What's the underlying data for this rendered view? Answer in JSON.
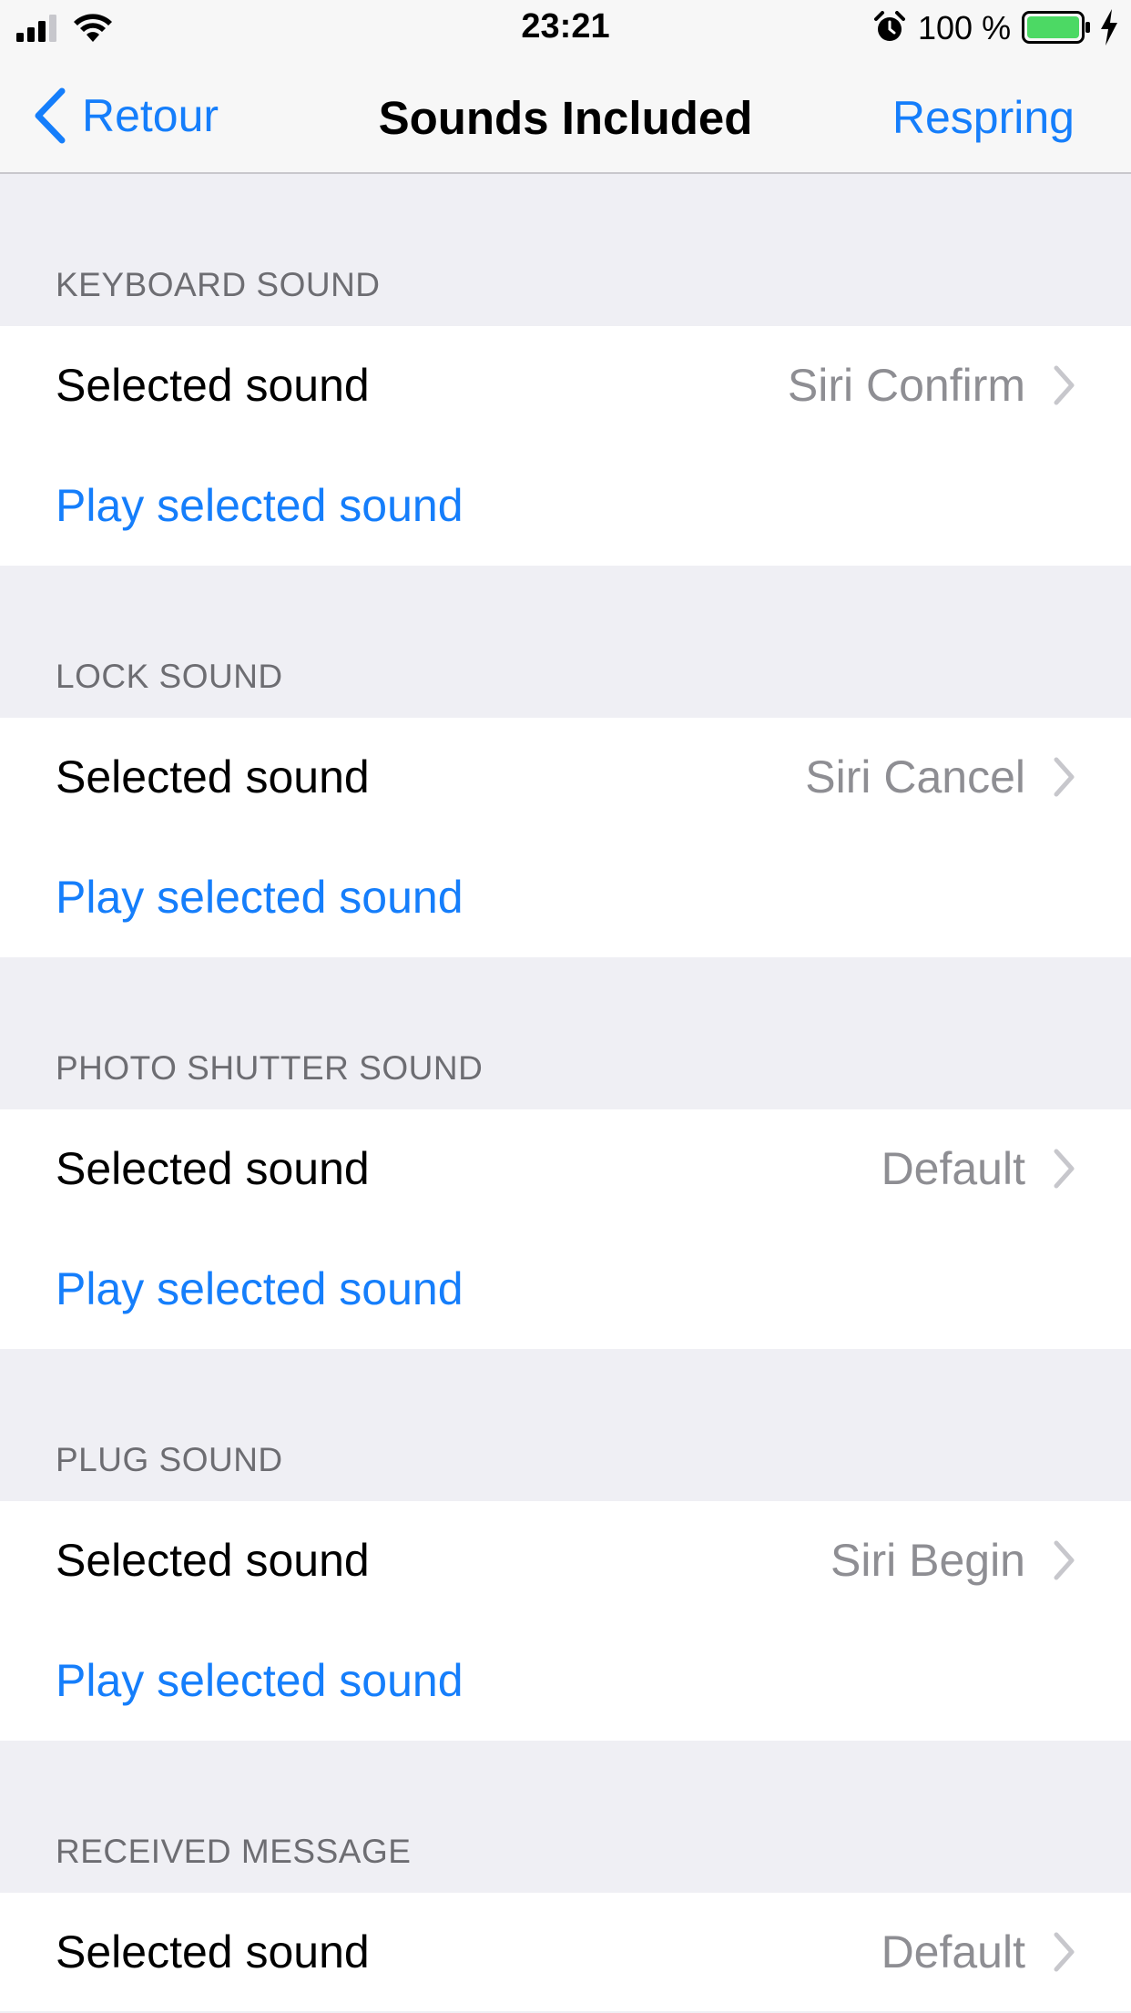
{
  "status_bar": {
    "time": "23:21",
    "battery_percent": "100 %",
    "battery_level": 1.0,
    "charging": true,
    "icons": [
      "signal-icon",
      "wifi-icon",
      "alarm-icon",
      "battery-icon",
      "charging-bolt-icon"
    ]
  },
  "nav": {
    "back_label": "Retour",
    "title": "Sounds Included",
    "right_button": "Respring"
  },
  "colors": {
    "accent": "#157efb",
    "background": "#efeff4",
    "value_gray": "#8e8e93",
    "header_gray": "#6d6d72",
    "battery_green": "#4cd964"
  },
  "sections": [
    {
      "header": "KEYBOARD SOUND",
      "selected_label": "Selected sound",
      "selected_value": "Siri Confirm",
      "play_label": "Play selected sound"
    },
    {
      "header": "LOCK SOUND",
      "selected_label": "Selected sound",
      "selected_value": "Siri Cancel",
      "play_label": "Play selected sound"
    },
    {
      "header": "PHOTO SHUTTER SOUND",
      "selected_label": "Selected sound",
      "selected_value": "Default",
      "play_label": "Play selected sound"
    },
    {
      "header": "PLUG SOUND",
      "selected_label": "Selected sound",
      "selected_value": "Siri Begin",
      "play_label": "Play selected sound"
    },
    {
      "header": "RECEIVED MESSAGE",
      "selected_label": "Selected sound",
      "selected_value": "Default"
    }
  ]
}
